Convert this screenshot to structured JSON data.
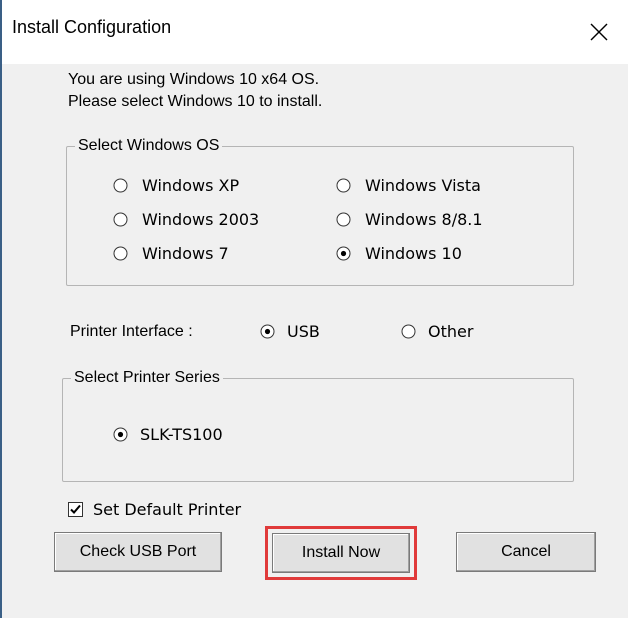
{
  "window": {
    "title": "Install Configuration",
    "close_glyph": "✕"
  },
  "info": {
    "line1": "You are using Windows 10 x64 OS.",
    "line2": "Please select Windows 10 to install."
  },
  "os_group": {
    "legend": "Select Windows OS",
    "options": [
      {
        "label": "Windows XP",
        "selected": false
      },
      {
        "label": "Windows Vista",
        "selected": false
      },
      {
        "label": "Windows 2003",
        "selected": false
      },
      {
        "label": "Windows 8/8.1",
        "selected": false
      },
      {
        "label": "Windows 7",
        "selected": false
      },
      {
        "label": "Windows 10",
        "selected": true
      }
    ]
  },
  "interface": {
    "label": "Printer Interface :",
    "options": [
      {
        "label": "USB",
        "selected": true
      },
      {
        "label": "Other",
        "selected": false
      }
    ]
  },
  "series_group": {
    "legend": "Select Printer Series",
    "options": [
      {
        "label": "SLK-TS100",
        "selected": true
      }
    ]
  },
  "default_printer": {
    "label": "Set Default Printer",
    "checked": true
  },
  "buttons": {
    "check_usb": "Check USB Port",
    "install_now": "Install Now",
    "cancel": "Cancel"
  },
  "colors": {
    "highlight": "#e03a3a",
    "dialog_bg": "#f0f0f0",
    "window_border": "#3a5f86"
  }
}
